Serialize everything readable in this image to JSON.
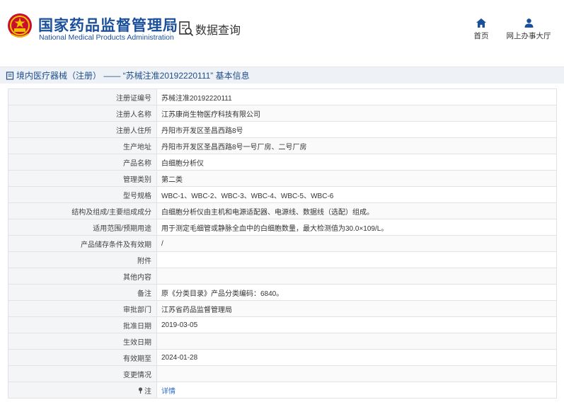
{
  "header": {
    "org_name_cn": "国家药品监督管理局",
    "org_name_en": "National Medical Products Administration",
    "data_query_label": "数据查询",
    "nav": [
      {
        "label": "首页",
        "icon": "home-icon"
      },
      {
        "label": "网上办事大厅",
        "icon": "user-icon"
      }
    ]
  },
  "title_bar": {
    "text": "境内医疗器械（注册） —— “苏械注准20192220111” 基本信息"
  },
  "colors": {
    "brand_blue": "#1a4f9c",
    "link_blue": "#2a6ac9",
    "emblem_red": "#c8102e",
    "emblem_gold": "#f2c200"
  },
  "rows": [
    {
      "label": "注册证编号",
      "value": "苏械注准20192220111"
    },
    {
      "label": "注册人名称",
      "value": "江苏康尚生物医疗科技有限公司"
    },
    {
      "label": "注册人住所",
      "value": "丹阳市开发区圣昌西路8号"
    },
    {
      "label": "生产地址",
      "value": "丹阳市开发区圣昌西路8号一号厂房、二号厂房"
    },
    {
      "label": "产品名称",
      "value": "白细胞分析仪"
    },
    {
      "label": "管理类别",
      "value": "第二类"
    },
    {
      "label": "型号规格",
      "value": "WBC-1、WBC-2、WBC-3、WBC-4、WBC-5、WBC-6"
    },
    {
      "label": "结构及组成/主要组成成分",
      "value": "白细胞分析仪由主机和电源适配器、电源线、数据线（选配）组成。"
    },
    {
      "label": "适用范围/预期用途",
      "value": "用于测定毛细管或静脉全血中的白细胞数量，最大检测值为30.0×109/L。"
    },
    {
      "label": "产品储存条件及有效期",
      "value": "/"
    },
    {
      "label": "附件",
      "value": ""
    },
    {
      "label": "其他内容",
      "value": ""
    },
    {
      "label": "备注",
      "value": "原《分类目录》产品分类编码：6840。"
    },
    {
      "label": "审批部门",
      "value": "江苏省药品监督管理局"
    },
    {
      "label": "批准日期",
      "value": "2019-03-05"
    },
    {
      "label": "生效日期",
      "value": ""
    },
    {
      "label": "有效期至",
      "value": "2024-01-28"
    },
    {
      "label": "变更情况",
      "value": ""
    }
  ],
  "note_row": {
    "label": "注",
    "link_text": "详情"
  }
}
